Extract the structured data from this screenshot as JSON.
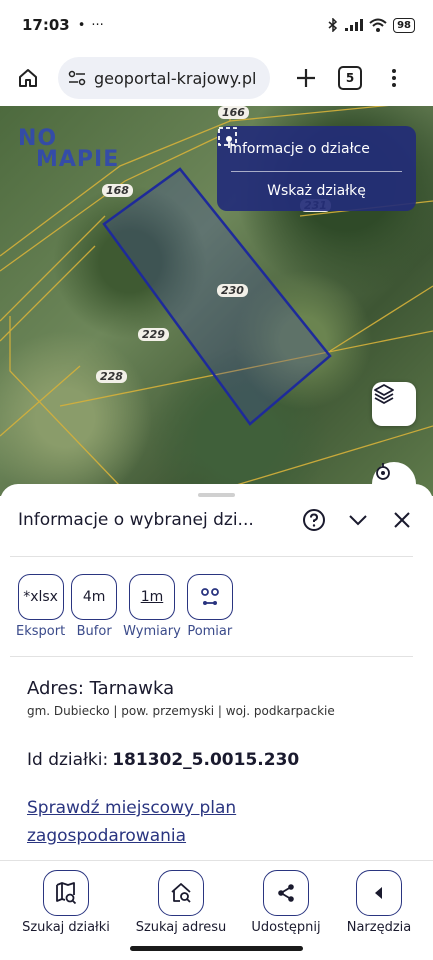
{
  "status_bar": {
    "time": "17:03",
    "notif_dot": "•",
    "more": "···",
    "battery": "98"
  },
  "browser": {
    "url": "geoportal-krajowy.pl",
    "tab_count": "5"
  },
  "map": {
    "logo_line1": "NO",
    "logo_line2": "MAPIE",
    "parcel_labels": [
      "166",
      "168",
      "230",
      "229",
      "228",
      "231"
    ],
    "info_panel": {
      "title": "Informacje o działce",
      "action": "Wskaż działkę"
    }
  },
  "sheet": {
    "title": "Informacje o wybranej dzi...",
    "tools": [
      {
        "box": "*xlsx",
        "label": "Eksport"
      },
      {
        "box": "4m",
        "label": "Bufor"
      },
      {
        "box": "1m",
        "label": "Wymiary"
      },
      {
        "box": "",
        "label": "Pomiar"
      }
    ],
    "address_title": "Adres: Tarnawka",
    "address_sub": "gm. Dubiecko | pow. przemyski | woj. podkarpackie",
    "id_label": "Id działki:",
    "id_value": "181302_5.0015.230",
    "plan_link": "Sprawdź miejscowy plan zagospodarowania"
  },
  "bottom_nav": [
    {
      "label": "Szukaj działki",
      "icon": "map-search-icon"
    },
    {
      "label": "Szukaj adresu",
      "icon": "home-search-icon"
    },
    {
      "label": "Udostępnij",
      "icon": "share-icon"
    },
    {
      "label": "Narzędzia",
      "icon": "chevron-left-icon"
    }
  ],
  "colors": {
    "accent": "#2a3580",
    "panel": "#232d78",
    "parcel_border": "#1e2a9a"
  }
}
